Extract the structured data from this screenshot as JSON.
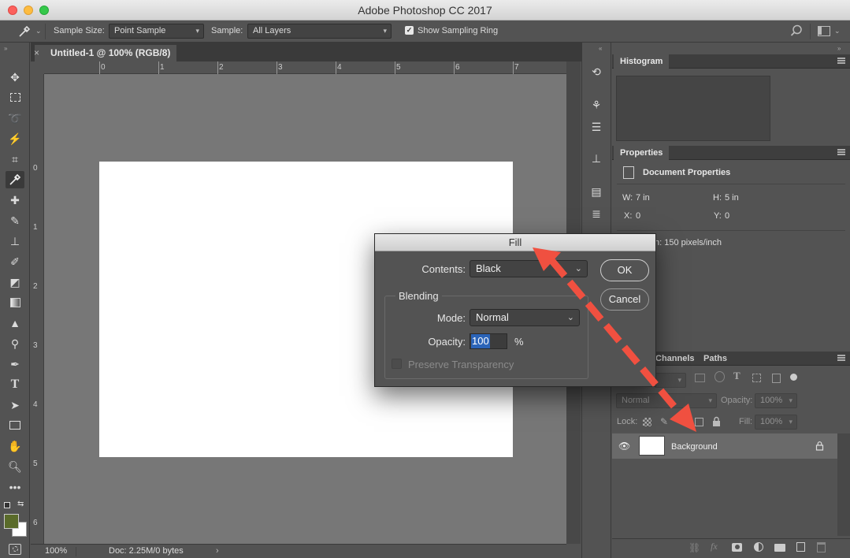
{
  "app": {
    "title": "Adobe Photoshop CC 2017"
  },
  "options_bar": {
    "sample_size_label": "Sample Size:",
    "sample_size_value": "Point Sample",
    "sample_label": "Sample:",
    "sample_value": "All Layers",
    "sampling_ring_label": "Show Sampling Ring",
    "sampling_ring_checked": true
  },
  "document": {
    "tab_label": "Untitled-1 @ 100% (RGB/8)",
    "ruler_h": [
      "0",
      "1",
      "2",
      "3",
      "4",
      "5",
      "6",
      "7"
    ],
    "ruler_v": [
      "0",
      "1",
      "2",
      "3",
      "4",
      "5",
      "6"
    ],
    "zoom": "100%",
    "doc_info": "Doc: 2.25M/0 bytes"
  },
  "panels": {
    "histogram": {
      "tab": "Histogram"
    },
    "properties": {
      "tab": "Properties",
      "title": "Document Properties",
      "w_label": "W:",
      "w_value": "7 in",
      "h_label": "H:",
      "h_value": "5 in",
      "x_label": "X:",
      "x_value": "0",
      "y_label": "Y:",
      "y_value": "0",
      "resolution": "n: 150 pixels/inch"
    },
    "layers": {
      "tabs": [
        "Channels",
        "Paths"
      ],
      "blend_mode": "Normal",
      "opacity_label": "Opacity:",
      "opacity_value": "100%",
      "lock_label": "Lock:",
      "fill_label": "Fill:",
      "fill_value": "100%",
      "layer_name": "Background"
    }
  },
  "fill_dialog": {
    "title": "Fill",
    "contents_label": "Contents:",
    "contents_value": "Black",
    "blending_label": "Blending",
    "mode_label": "Mode:",
    "mode_value": "Normal",
    "opacity_label": "Opacity:",
    "opacity_value": "100",
    "opacity_unit": "%",
    "preserve_label": "Preserve Transparency",
    "ok_label": "OK",
    "cancel_label": "Cancel"
  },
  "colors": {
    "foreground": "#5a6b2a",
    "background": "#ffffff",
    "arrow": "#f05040"
  }
}
